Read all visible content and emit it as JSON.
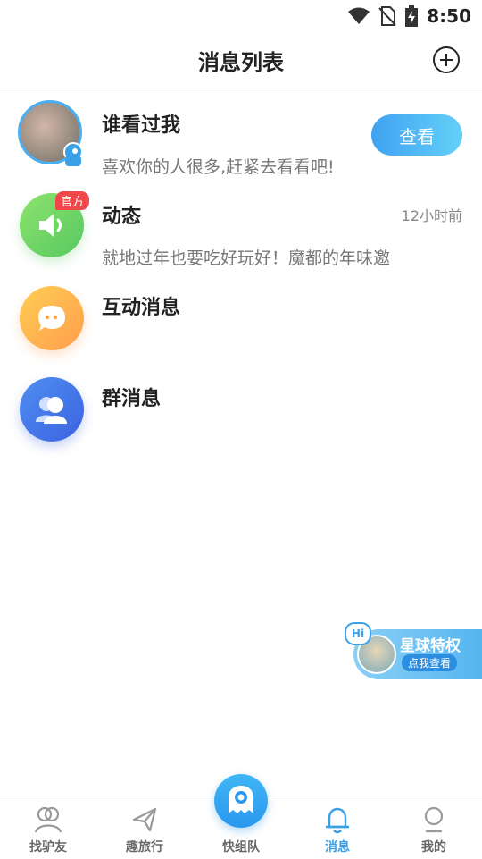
{
  "status_bar": {
    "time": "8:50"
  },
  "header": {
    "title": "消息列表"
  },
  "rows": [
    {
      "title": "谁看过我",
      "subtitle": "喜欢你的人很多,赶紧去看看吧!",
      "button": "查看"
    },
    {
      "title": "动态",
      "subtitle": "就地过年也要吃好玩好！魔都的年味邀",
      "time": "12小时前",
      "badge": "官方"
    },
    {
      "title": "互动消息"
    },
    {
      "title": "群消息"
    }
  ],
  "promo": {
    "badge": "Hi",
    "title": "星球特权",
    "subtitle": "点我查看"
  },
  "tabbar": {
    "items": [
      {
        "label": "找驴友",
        "icon": "friends-icon"
      },
      {
        "label": "趣旅行",
        "icon": "plane-icon"
      },
      {
        "label": "快组队",
        "icon": "team-icon"
      },
      {
        "label": "消息",
        "icon": "bell-icon",
        "active": true
      },
      {
        "label": "我的",
        "icon": "profile-icon"
      }
    ]
  },
  "colors": {
    "accent": "#3aa0e8",
    "badge": "#f0474b",
    "green": "#6fd16a",
    "orange": "#ffab4c",
    "blue": "#3c76ea"
  }
}
